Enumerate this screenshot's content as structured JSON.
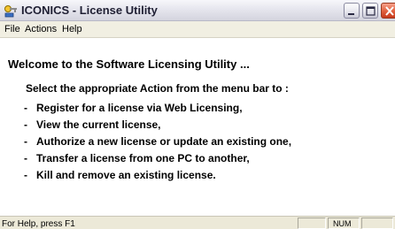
{
  "window": {
    "title": "ICONICS - License Utility",
    "icon": "license-key-icon"
  },
  "title_buttons": {
    "minimize_icon": "minimize-icon",
    "maximize_icon": "maximize-icon",
    "close_icon": "close-icon"
  },
  "menu": {
    "items": [
      {
        "label": "File"
      },
      {
        "label": "Actions"
      },
      {
        "label": "Help"
      }
    ]
  },
  "content": {
    "welcome": "Welcome to the Software Licensing Utility ...",
    "instruction": "Select the appropriate  Action  from the menu bar to :",
    "bullet": "-",
    "actions": [
      "Register for a license via Web Licensing,",
      "View the current license,",
      "Authorize a new license or update an existing one,",
      "Transfer a license from one PC to another,",
      "Kill and remove an existing license."
    ]
  },
  "statusbar": {
    "help_text": "For Help, press F1",
    "num_indicator": "NUM"
  },
  "colors": {
    "close_button": "#e0603e",
    "menu_background": "#f1efe2",
    "statusbar_background": "#ece9d8"
  }
}
